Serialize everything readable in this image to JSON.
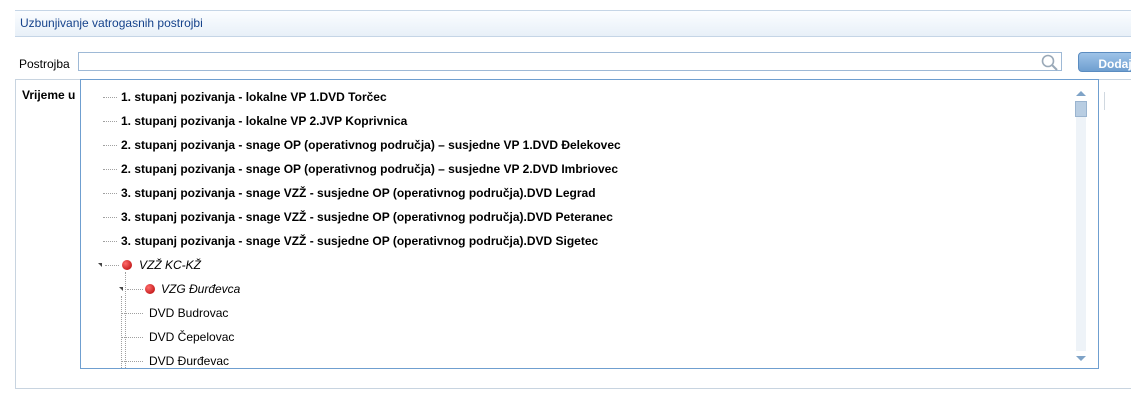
{
  "panel": {
    "title": "Uzbunjivanje vatrogasnih postrojbi"
  },
  "form": {
    "postrojba_label": "Postrojba",
    "search_value": "",
    "add_button_label": "Dodaj"
  },
  "grid": {
    "columns": [
      "Vrijeme u"
    ]
  },
  "dropdown": {
    "items": [
      "1. stupanj pozivanja - lokalne VP 1.DVD Torčec",
      "1. stupanj pozivanja - lokalne VP 2.JVP Koprivnica",
      "2. stupanj pozivanja - snage OP (operativnog područja) – susjedne VP 1.DVD Đelekovec",
      "2. stupanj pozivanja - snage OP (operativnog područja) – susjedne VP 2.DVD Imbriovec",
      "3. stupanj pozivanja - snage VZŽ - susjedne OP (operativnog područja).DVD Legrad",
      "3. stupanj pozivanja - snage VZŽ - susjedne OP (operativnog područja).DVD Peteranec",
      "3. stupanj pozivanja - snage VZŽ - susjedne OP (operativnog područja).DVD Sigetec"
    ],
    "tree": {
      "root_label": "VZŽ KC-KŽ",
      "child_label": "VZG Đurđevca",
      "leaves": [
        "DVD Budrovac",
        "DVD Čepelovac",
        "DVD Đurđevac"
      ]
    }
  },
  "colors": {
    "accent": "#6f9fd0",
    "header_text": "#15428b",
    "node_dot": "#cc0000"
  }
}
